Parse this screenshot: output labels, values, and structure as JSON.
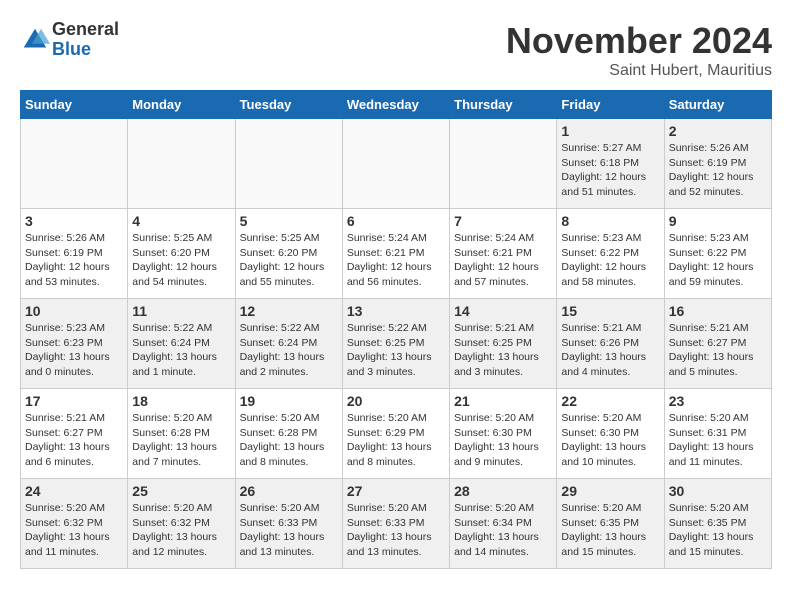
{
  "logo": {
    "general": "General",
    "blue": "Blue"
  },
  "header": {
    "month": "November 2024",
    "location": "Saint Hubert, Mauritius"
  },
  "days_of_week": [
    "Sunday",
    "Monday",
    "Tuesday",
    "Wednesday",
    "Thursday",
    "Friday",
    "Saturday"
  ],
  "weeks": [
    [
      {
        "day": "",
        "info": "",
        "empty": true
      },
      {
        "day": "",
        "info": "",
        "empty": true
      },
      {
        "day": "",
        "info": "",
        "empty": true
      },
      {
        "day": "",
        "info": "",
        "empty": true
      },
      {
        "day": "",
        "info": "",
        "empty": true
      },
      {
        "day": "1",
        "info": "Sunrise: 5:27 AM\nSunset: 6:18 PM\nDaylight: 12 hours\nand 51 minutes.",
        "empty": false
      },
      {
        "day": "2",
        "info": "Sunrise: 5:26 AM\nSunset: 6:19 PM\nDaylight: 12 hours\nand 52 minutes.",
        "empty": false
      }
    ],
    [
      {
        "day": "3",
        "info": "Sunrise: 5:26 AM\nSunset: 6:19 PM\nDaylight: 12 hours\nand 53 minutes.",
        "empty": false
      },
      {
        "day": "4",
        "info": "Sunrise: 5:25 AM\nSunset: 6:20 PM\nDaylight: 12 hours\nand 54 minutes.",
        "empty": false
      },
      {
        "day": "5",
        "info": "Sunrise: 5:25 AM\nSunset: 6:20 PM\nDaylight: 12 hours\nand 55 minutes.",
        "empty": false
      },
      {
        "day": "6",
        "info": "Sunrise: 5:24 AM\nSunset: 6:21 PM\nDaylight: 12 hours\nand 56 minutes.",
        "empty": false
      },
      {
        "day": "7",
        "info": "Sunrise: 5:24 AM\nSunset: 6:21 PM\nDaylight: 12 hours\nand 57 minutes.",
        "empty": false
      },
      {
        "day": "8",
        "info": "Sunrise: 5:23 AM\nSunset: 6:22 PM\nDaylight: 12 hours\nand 58 minutes.",
        "empty": false
      },
      {
        "day": "9",
        "info": "Sunrise: 5:23 AM\nSunset: 6:22 PM\nDaylight: 12 hours\nand 59 minutes.",
        "empty": false
      }
    ],
    [
      {
        "day": "10",
        "info": "Sunrise: 5:23 AM\nSunset: 6:23 PM\nDaylight: 13 hours\nand 0 minutes.",
        "empty": false
      },
      {
        "day": "11",
        "info": "Sunrise: 5:22 AM\nSunset: 6:24 PM\nDaylight: 13 hours\nand 1 minute.",
        "empty": false
      },
      {
        "day": "12",
        "info": "Sunrise: 5:22 AM\nSunset: 6:24 PM\nDaylight: 13 hours\nand 2 minutes.",
        "empty": false
      },
      {
        "day": "13",
        "info": "Sunrise: 5:22 AM\nSunset: 6:25 PM\nDaylight: 13 hours\nand 3 minutes.",
        "empty": false
      },
      {
        "day": "14",
        "info": "Sunrise: 5:21 AM\nSunset: 6:25 PM\nDaylight: 13 hours\nand 3 minutes.",
        "empty": false
      },
      {
        "day": "15",
        "info": "Sunrise: 5:21 AM\nSunset: 6:26 PM\nDaylight: 13 hours\nand 4 minutes.",
        "empty": false
      },
      {
        "day": "16",
        "info": "Sunrise: 5:21 AM\nSunset: 6:27 PM\nDaylight: 13 hours\nand 5 minutes.",
        "empty": false
      }
    ],
    [
      {
        "day": "17",
        "info": "Sunrise: 5:21 AM\nSunset: 6:27 PM\nDaylight: 13 hours\nand 6 minutes.",
        "empty": false
      },
      {
        "day": "18",
        "info": "Sunrise: 5:20 AM\nSunset: 6:28 PM\nDaylight: 13 hours\nand 7 minutes.",
        "empty": false
      },
      {
        "day": "19",
        "info": "Sunrise: 5:20 AM\nSunset: 6:28 PM\nDaylight: 13 hours\nand 8 minutes.",
        "empty": false
      },
      {
        "day": "20",
        "info": "Sunrise: 5:20 AM\nSunset: 6:29 PM\nDaylight: 13 hours\nand 8 minutes.",
        "empty": false
      },
      {
        "day": "21",
        "info": "Sunrise: 5:20 AM\nSunset: 6:30 PM\nDaylight: 13 hours\nand 9 minutes.",
        "empty": false
      },
      {
        "day": "22",
        "info": "Sunrise: 5:20 AM\nSunset: 6:30 PM\nDaylight: 13 hours\nand 10 minutes.",
        "empty": false
      },
      {
        "day": "23",
        "info": "Sunrise: 5:20 AM\nSunset: 6:31 PM\nDaylight: 13 hours\nand 11 minutes.",
        "empty": false
      }
    ],
    [
      {
        "day": "24",
        "info": "Sunrise: 5:20 AM\nSunset: 6:32 PM\nDaylight: 13 hours\nand 11 minutes.",
        "empty": false
      },
      {
        "day": "25",
        "info": "Sunrise: 5:20 AM\nSunset: 6:32 PM\nDaylight: 13 hours\nand 12 minutes.",
        "empty": false
      },
      {
        "day": "26",
        "info": "Sunrise: 5:20 AM\nSunset: 6:33 PM\nDaylight: 13 hours\nand 13 minutes.",
        "empty": false
      },
      {
        "day": "27",
        "info": "Sunrise: 5:20 AM\nSunset: 6:33 PM\nDaylight: 13 hours\nand 13 minutes.",
        "empty": false
      },
      {
        "day": "28",
        "info": "Sunrise: 5:20 AM\nSunset: 6:34 PM\nDaylight: 13 hours\nand 14 minutes.",
        "empty": false
      },
      {
        "day": "29",
        "info": "Sunrise: 5:20 AM\nSunset: 6:35 PM\nDaylight: 13 hours\nand 15 minutes.",
        "empty": false
      },
      {
        "day": "30",
        "info": "Sunrise: 5:20 AM\nSunset: 6:35 PM\nDaylight: 13 hours\nand 15 minutes.",
        "empty": false
      }
    ]
  ]
}
